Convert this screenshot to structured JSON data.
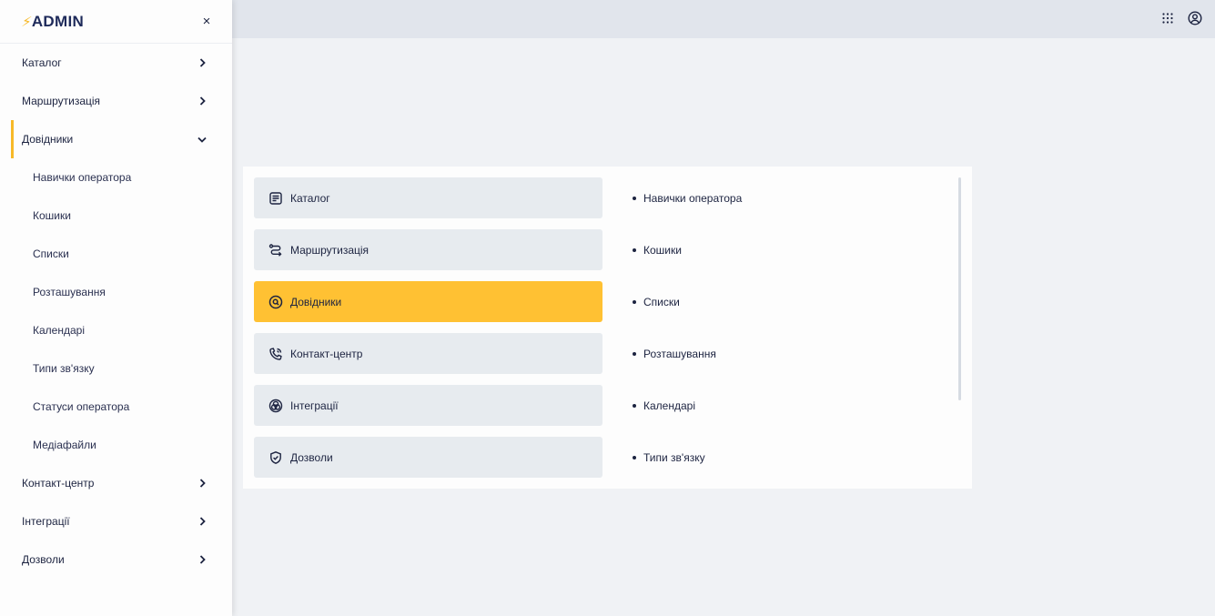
{
  "app": {
    "logo_text": "ADMIN",
    "logo_mark": "⚡",
    "close_label": "×"
  },
  "topbar": {
    "apps_icon": "grid-dots-icon",
    "user_icon": "user-circle-icon"
  },
  "sidebar": {
    "items": [
      {
        "label": "Каталог",
        "state": "collapsed"
      },
      {
        "label": "Маршрутизація",
        "state": "collapsed"
      },
      {
        "label": "Довідники",
        "state": "expanded"
      },
      {
        "label": "Контакт-центр",
        "state": "collapsed"
      },
      {
        "label": "Інтеграції",
        "state": "collapsed"
      },
      {
        "label": "Дозволи",
        "state": "collapsed"
      }
    ],
    "subitems": [
      {
        "label": "Навички оператора"
      },
      {
        "label": "Кошики"
      },
      {
        "label": "Списки"
      },
      {
        "label": "Розташування"
      },
      {
        "label": "Календарі"
      },
      {
        "label": "Типи зв'язку"
      },
      {
        "label": "Статуси оператора"
      },
      {
        "label": "Медіафайли"
      }
    ]
  },
  "main": {
    "menu": [
      {
        "label": "Каталог",
        "icon": "catalog-icon"
      },
      {
        "label": "Маршрутизація",
        "icon": "routing-icon"
      },
      {
        "label": "Довідники",
        "icon": "search-circle-icon",
        "active": true
      },
      {
        "label": "Контакт-центр",
        "icon": "phone-icon"
      },
      {
        "label": "Інтеграції",
        "icon": "integrations-icon"
      },
      {
        "label": "Дозволи",
        "icon": "shield-check-icon"
      }
    ],
    "list": [
      {
        "label": "Навички оператора"
      },
      {
        "label": "Кошики"
      },
      {
        "label": "Списки"
      },
      {
        "label": "Розташування"
      },
      {
        "label": "Календарі"
      },
      {
        "label": "Типи зв'язку"
      }
    ]
  },
  "colors": {
    "accent": "#ffc133",
    "sidebar_active_bar": "#f7b928",
    "text": "#1c2340",
    "topbar": "#e1e5ec",
    "button_bg": "#e7ebef"
  }
}
